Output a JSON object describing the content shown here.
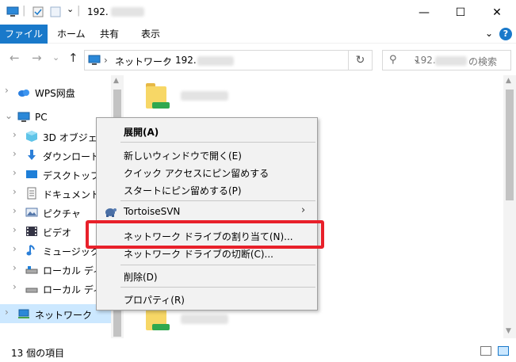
{
  "window": {
    "title_prefix": "192.",
    "minimize_glyph": "—",
    "maximize_glyph": "☐",
    "close_glyph": "✕"
  },
  "ribbon": {
    "tabs": [
      "ファイル",
      "ホーム",
      "共有",
      "表示"
    ],
    "collapse_glyph": "⌄",
    "help_glyph": "?"
  },
  "nav": {
    "back_glyph": "←",
    "forward_glyph": "→",
    "recent_glyph": "⌄",
    "up_glyph": "↑",
    "breadcrumb": [
      "ネットワーク",
      "192."
    ],
    "crumb_separator": "›",
    "dropdown_glyph": "⌄",
    "refresh_glyph": "↻",
    "search_prefix": "192.",
    "search_suffix": "の検索",
    "search_glyph": "⚲"
  },
  "tree": {
    "items": [
      {
        "label": "WPS网盘",
        "icon": "cloud-icon",
        "indent": 0,
        "chevron": "›"
      },
      {
        "label": "PC",
        "icon": "pc-icon",
        "indent": 0,
        "chevron": "⌄"
      },
      {
        "label": "3D オブジェクト",
        "icon": "cube-icon",
        "indent": 1,
        "chevron": "›"
      },
      {
        "label": "ダウンロード",
        "icon": "download-icon",
        "indent": 1,
        "chevron": "›"
      },
      {
        "label": "デスクトップ",
        "icon": "desktop-icon",
        "indent": 1,
        "chevron": "›"
      },
      {
        "label": "ドキュメント",
        "icon": "document-icon",
        "indent": 1,
        "chevron": "›"
      },
      {
        "label": "ピクチャ",
        "icon": "picture-icon",
        "indent": 1,
        "chevron": "›"
      },
      {
        "label": "ビデオ",
        "icon": "video-icon",
        "indent": 1,
        "chevron": "›"
      },
      {
        "label": "ミュージック",
        "icon": "music-icon",
        "indent": 1,
        "chevron": "›"
      },
      {
        "label": "ローカル ディスク",
        "icon": "disk-icon",
        "indent": 1,
        "chevron": "›"
      },
      {
        "label": "ローカル ディスク",
        "icon": "disk-icon",
        "indent": 1,
        "chevron": "›"
      },
      {
        "label": "ネットワーク",
        "icon": "network-icon",
        "indent": 0,
        "chevron": "›"
      }
    ]
  },
  "context_menu": {
    "items": {
      "expand": "展開(A)",
      "open_new_window": "新しいウィンドウで開く(E)",
      "pin_quick_access": "クイック アクセスにピン留めする",
      "pin_start": "スタートにピン留めする(P)",
      "tortoisesvn": "TortoiseSVN",
      "map_network_drive": "ネットワーク ドライブの割り当て(N)...",
      "disconnect_network_drive": "ネットワーク ドライブの切断(C)...",
      "delete": "削除(D)",
      "properties": "プロパティ(R)"
    },
    "submenu_arrow": "›"
  },
  "status": {
    "item_count": "13 個の項目"
  },
  "colors": {
    "accent": "#1979ca",
    "selection": "#cce8ff",
    "highlight_box": "#e8202a",
    "menu_bg": "#f2f2f2"
  }
}
